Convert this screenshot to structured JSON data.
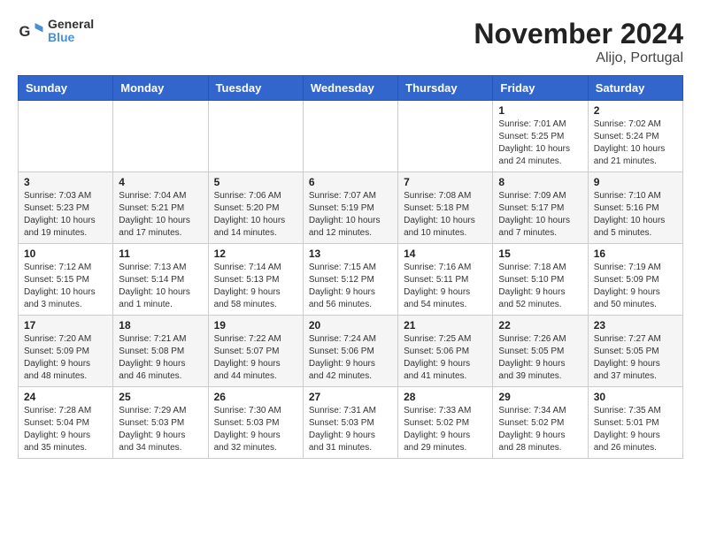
{
  "header": {
    "logo_line1": "General",
    "logo_line2": "Blue",
    "title": "November 2024",
    "subtitle": "Alijo, Portugal"
  },
  "weekdays": [
    "Sunday",
    "Monday",
    "Tuesday",
    "Wednesday",
    "Thursday",
    "Friday",
    "Saturday"
  ],
  "weeks": [
    [
      {
        "day": "",
        "info": ""
      },
      {
        "day": "",
        "info": ""
      },
      {
        "day": "",
        "info": ""
      },
      {
        "day": "",
        "info": ""
      },
      {
        "day": "",
        "info": ""
      },
      {
        "day": "1",
        "info": "Sunrise: 7:01 AM\nSunset: 5:25 PM\nDaylight: 10 hours and 24 minutes."
      },
      {
        "day": "2",
        "info": "Sunrise: 7:02 AM\nSunset: 5:24 PM\nDaylight: 10 hours and 21 minutes."
      }
    ],
    [
      {
        "day": "3",
        "info": "Sunrise: 7:03 AM\nSunset: 5:23 PM\nDaylight: 10 hours and 19 minutes."
      },
      {
        "day": "4",
        "info": "Sunrise: 7:04 AM\nSunset: 5:21 PM\nDaylight: 10 hours and 17 minutes."
      },
      {
        "day": "5",
        "info": "Sunrise: 7:06 AM\nSunset: 5:20 PM\nDaylight: 10 hours and 14 minutes."
      },
      {
        "day": "6",
        "info": "Sunrise: 7:07 AM\nSunset: 5:19 PM\nDaylight: 10 hours and 12 minutes."
      },
      {
        "day": "7",
        "info": "Sunrise: 7:08 AM\nSunset: 5:18 PM\nDaylight: 10 hours and 10 minutes."
      },
      {
        "day": "8",
        "info": "Sunrise: 7:09 AM\nSunset: 5:17 PM\nDaylight: 10 hours and 7 minutes."
      },
      {
        "day": "9",
        "info": "Sunrise: 7:10 AM\nSunset: 5:16 PM\nDaylight: 10 hours and 5 minutes."
      }
    ],
    [
      {
        "day": "10",
        "info": "Sunrise: 7:12 AM\nSunset: 5:15 PM\nDaylight: 10 hours and 3 minutes."
      },
      {
        "day": "11",
        "info": "Sunrise: 7:13 AM\nSunset: 5:14 PM\nDaylight: 10 hours and 1 minute."
      },
      {
        "day": "12",
        "info": "Sunrise: 7:14 AM\nSunset: 5:13 PM\nDaylight: 9 hours and 58 minutes."
      },
      {
        "day": "13",
        "info": "Sunrise: 7:15 AM\nSunset: 5:12 PM\nDaylight: 9 hours and 56 minutes."
      },
      {
        "day": "14",
        "info": "Sunrise: 7:16 AM\nSunset: 5:11 PM\nDaylight: 9 hours and 54 minutes."
      },
      {
        "day": "15",
        "info": "Sunrise: 7:18 AM\nSunset: 5:10 PM\nDaylight: 9 hours and 52 minutes."
      },
      {
        "day": "16",
        "info": "Sunrise: 7:19 AM\nSunset: 5:09 PM\nDaylight: 9 hours and 50 minutes."
      }
    ],
    [
      {
        "day": "17",
        "info": "Sunrise: 7:20 AM\nSunset: 5:09 PM\nDaylight: 9 hours and 48 minutes."
      },
      {
        "day": "18",
        "info": "Sunrise: 7:21 AM\nSunset: 5:08 PM\nDaylight: 9 hours and 46 minutes."
      },
      {
        "day": "19",
        "info": "Sunrise: 7:22 AM\nSunset: 5:07 PM\nDaylight: 9 hours and 44 minutes."
      },
      {
        "day": "20",
        "info": "Sunrise: 7:24 AM\nSunset: 5:06 PM\nDaylight: 9 hours and 42 minutes."
      },
      {
        "day": "21",
        "info": "Sunrise: 7:25 AM\nSunset: 5:06 PM\nDaylight: 9 hours and 41 minutes."
      },
      {
        "day": "22",
        "info": "Sunrise: 7:26 AM\nSunset: 5:05 PM\nDaylight: 9 hours and 39 minutes."
      },
      {
        "day": "23",
        "info": "Sunrise: 7:27 AM\nSunset: 5:05 PM\nDaylight: 9 hours and 37 minutes."
      }
    ],
    [
      {
        "day": "24",
        "info": "Sunrise: 7:28 AM\nSunset: 5:04 PM\nDaylight: 9 hours and 35 minutes."
      },
      {
        "day": "25",
        "info": "Sunrise: 7:29 AM\nSunset: 5:03 PM\nDaylight: 9 hours and 34 minutes."
      },
      {
        "day": "26",
        "info": "Sunrise: 7:30 AM\nSunset: 5:03 PM\nDaylight: 9 hours and 32 minutes."
      },
      {
        "day": "27",
        "info": "Sunrise: 7:31 AM\nSunset: 5:03 PM\nDaylight: 9 hours and 31 minutes."
      },
      {
        "day": "28",
        "info": "Sunrise: 7:33 AM\nSunset: 5:02 PM\nDaylight: 9 hours and 29 minutes."
      },
      {
        "day": "29",
        "info": "Sunrise: 7:34 AM\nSunset: 5:02 PM\nDaylight: 9 hours and 28 minutes."
      },
      {
        "day": "30",
        "info": "Sunrise: 7:35 AM\nSunset: 5:01 PM\nDaylight: 9 hours and 26 minutes."
      }
    ]
  ]
}
